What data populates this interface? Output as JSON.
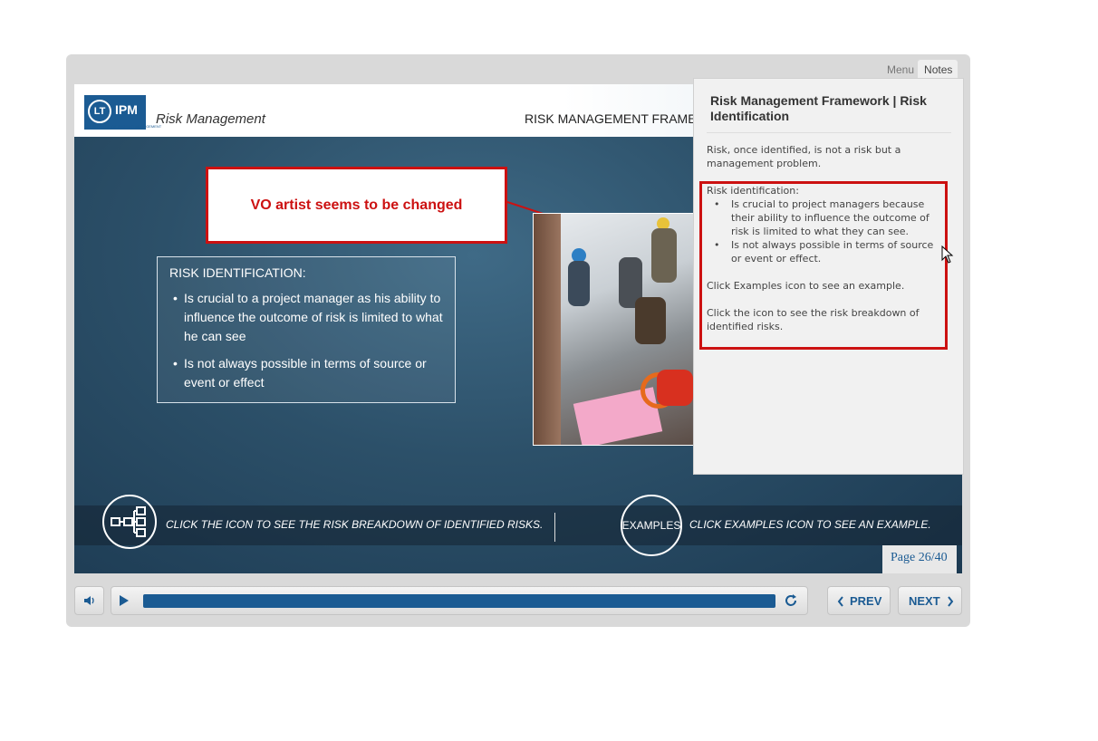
{
  "header": {
    "logo_text": "IPM",
    "logo_mark": "LT",
    "logo_sub": "L&T INSTITUTE OF PROJECT MANAGEMENT",
    "course_title": "Risk Management",
    "section_title": "RISK MANAGEMENT FRAMEW"
  },
  "callout": {
    "text": "VO artist seems to be changed"
  },
  "risk_box": {
    "heading": "RISK IDENTIFICATION:",
    "bullets": [
      "Is  crucial to a project manager as his ability to influence the outcome of risk is limited to what he can see",
      "Is not always possible in terms of source or event or effect"
    ]
  },
  "bottom_bar": {
    "left_text": "CLICK THE ICON TO SEE THE RISK BREAKDOWN OF IDENTIFIED RISKS.",
    "examples_label": "EXAMPLES",
    "right_text": "CLICK EXAMPLES ICON TO SEE AN EXAMPLE."
  },
  "page": {
    "label": "Page 26/40"
  },
  "tabs": {
    "menu": "Menu",
    "notes": "Notes"
  },
  "notes": {
    "title": "Risk Management Framework | Risk Identification",
    "para1": "Risk, once identified, is not a risk but a management problem.",
    "section_label": "Risk identification:",
    "bullets": [
      "Is  crucial to project managers because their ability to influence the outcome of risk is limited to what they can see.",
      "Is not always possible in terms of source or event or effect."
    ],
    "para2": "Click Examples icon to see an example.",
    "para3": "Click the icon to see the risk breakdown of identified risks."
  },
  "controls": {
    "progress": 1.0,
    "prev_label": "PREV",
    "next_label": "NEXT"
  },
  "colors": {
    "accent": "#1b5b93",
    "highlight": "#cc1111"
  }
}
